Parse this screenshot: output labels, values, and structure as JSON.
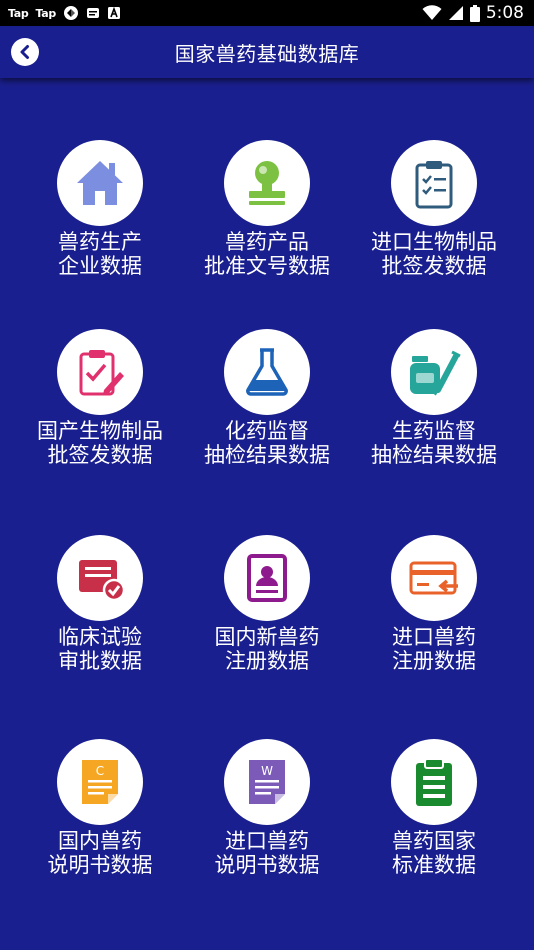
{
  "status_bar": {
    "app_tags": [
      "Tap",
      "Tap"
    ],
    "time": "5:08"
  },
  "header": {
    "title": "国家兽药基础数据库"
  },
  "tiles": [
    {
      "line1": "兽药生产",
      "line2": "企业数据",
      "icon": "house-icon",
      "color": "#7b8ee0"
    },
    {
      "line1": "兽药产品",
      "line2": "批准文号数据",
      "icon": "stamp-icon",
      "color": "#7cc142"
    },
    {
      "line1": "进口生物制品",
      "line2": "批签发数据",
      "icon": "clipboard-checklist-icon",
      "color": "#2f5b7c"
    },
    {
      "line1": "国产生物制品",
      "line2": "批签发数据",
      "icon": "clipboard-pencil-icon",
      "color": "#e0306e"
    },
    {
      "line1": "化药监督",
      "line2": "抽检结果数据",
      "icon": "flask-icon",
      "color": "#1d63b8"
    },
    {
      "line1": "生药监督",
      "line2": "抽检结果数据",
      "icon": "vial-syringe-icon",
      "color": "#26a69a"
    },
    {
      "line1": "临床试验",
      "line2": "审批数据",
      "icon": "document-approved-icon",
      "color": "#c8304a"
    },
    {
      "line1": "国内新兽药",
      "line2": "注册数据",
      "icon": "id-card-icon",
      "color": "#8e1b8e"
    },
    {
      "line1": "进口兽药",
      "line2": "注册数据",
      "icon": "card-import-icon",
      "color": "#e8622a"
    },
    {
      "line1": "国内兽药",
      "line2": "说明书数据",
      "icon": "doc-c-icon",
      "color": "#f5a623"
    },
    {
      "line1": "进口兽药",
      "line2": "说明书数据",
      "icon": "doc-w-icon",
      "color": "#7b5ab8"
    },
    {
      "line1": "兽药国家",
      "line2": "标准数据",
      "icon": "clipboard-list-icon",
      "color": "#1a8a2e"
    }
  ]
}
